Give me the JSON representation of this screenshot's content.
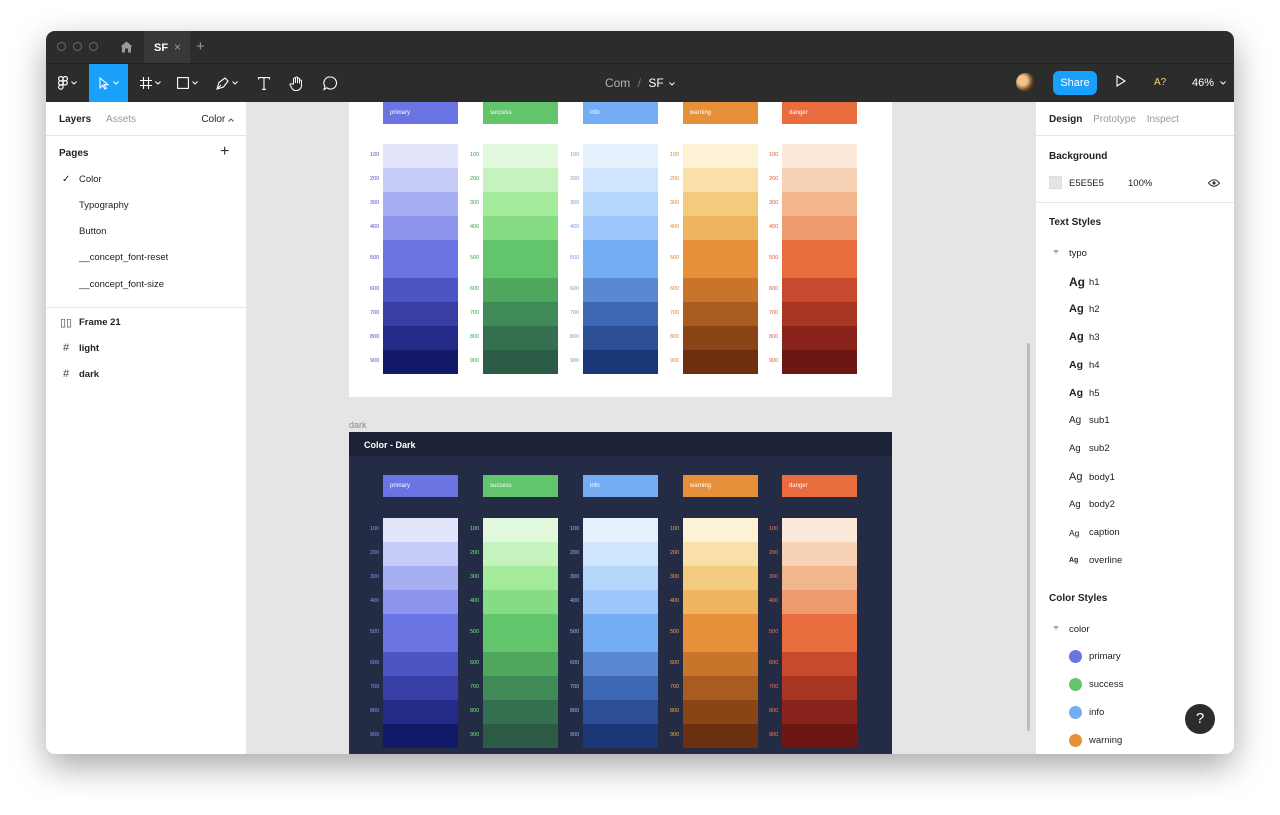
{
  "tabs": {
    "file_tab": "SF",
    "close": "×",
    "new": "+"
  },
  "toolbar": {
    "breadcrumb_project": "Com",
    "breadcrumb_sep": "/",
    "breadcrumb_file": "SF",
    "share": "Share",
    "font_warning": "A?",
    "zoom": "46%"
  },
  "left_panel": {
    "tab_layers": "Layers",
    "tab_assets": "Assets",
    "page_selector": "Color",
    "pages_title": "Pages",
    "add_page": "+",
    "pages": [
      "Color",
      "Typography",
      "Button",
      "__concept_font-reset",
      "__concept_font-size"
    ],
    "current_page_check": "✓",
    "layers": [
      {
        "name": "Frame 21",
        "icon": "auto-layout-icon"
      },
      {
        "name": "light",
        "icon": "frame-icon"
      },
      {
        "name": "dark",
        "icon": "frame-icon"
      }
    ]
  },
  "right_panel": {
    "tab_design": "Design",
    "tab_prototype": "Prototype",
    "tab_inspect": "Inspect",
    "background_title": "Background",
    "background_hex": "E5E5E5",
    "background_opacity": "100%",
    "text_styles_title": "Text Styles",
    "text_group": "typo",
    "text_styles": [
      "h1",
      "h2",
      "h3",
      "h4",
      "h5",
      "sub1",
      "sub2",
      "body1",
      "body2",
      "caption",
      "overline"
    ],
    "ag": "Ag",
    "color_styles_title": "Color Styles",
    "color_group": "color",
    "color_styles": [
      {
        "name": "primary",
        "color": "#6b74e3"
      },
      {
        "name": "success",
        "color": "#62c46b"
      },
      {
        "name": "info",
        "color": "#75adf5"
      },
      {
        "name": "warning",
        "color": "#e6913a"
      }
    ]
  },
  "help": "?",
  "canvas": {
    "dark_frame_label": "dark",
    "dark_frame_title": "Color - Dark",
    "shades": [
      "100",
      "200",
      "300",
      "400",
      "500",
      "600",
      "700",
      "800",
      "900"
    ],
    "palettes": [
      {
        "name": "primary",
        "label_color": "#4a50c9",
        "dark_label_color": "#8d96ff",
        "colors": [
          "#e3e5fb",
          "#c6caf6",
          "#a8aef2",
          "#8c94ee",
          "#6b74e3",
          "#4c55c4",
          "#373fa5",
          "#232a87",
          "#111968"
        ]
      },
      {
        "name": "success",
        "label_color": "#3e9e48",
        "dark_label_color": "#78e383",
        "colors": [
          "#e1f8dd",
          "#c4f3bd",
          "#a3ea9a",
          "#86dc82",
          "#62c46b",
          "#4fa65d",
          "#3f8a56",
          "#346f4f",
          "#2b5b45"
        ]
      },
      {
        "name": "info",
        "label_color": "#6e9fd9",
        "dark_label_color": "#8ebcfa",
        "colors": [
          "#e5f2fe",
          "#cfe5fd",
          "#b5d6fb",
          "#9dc6fa",
          "#75adf5",
          "#5a88d3",
          "#3f68b4",
          "#2c4e95",
          "#1a3778"
        ]
      },
      {
        "name": "warning",
        "label_color": "#d8852e",
        "dark_label_color": "#f2a54f",
        "colors": [
          "#fdf1d6",
          "#f9e0a8",
          "#f3cb7f",
          "#eeb45f",
          "#e6913a",
          "#c8742b",
          "#a95c1f",
          "#8a4517",
          "#6c3011"
        ]
      },
      {
        "name": "danger",
        "label_color": "#e15a33",
        "dark_label_color": "#f47a55",
        "colors": [
          "#fbe8d9",
          "#f7d2b5",
          "#f2b68d",
          "#ee9a6c",
          "#e96c3f",
          "#c84a2e",
          "#a93523",
          "#8a231b",
          "#6d1714"
        ]
      }
    ]
  }
}
